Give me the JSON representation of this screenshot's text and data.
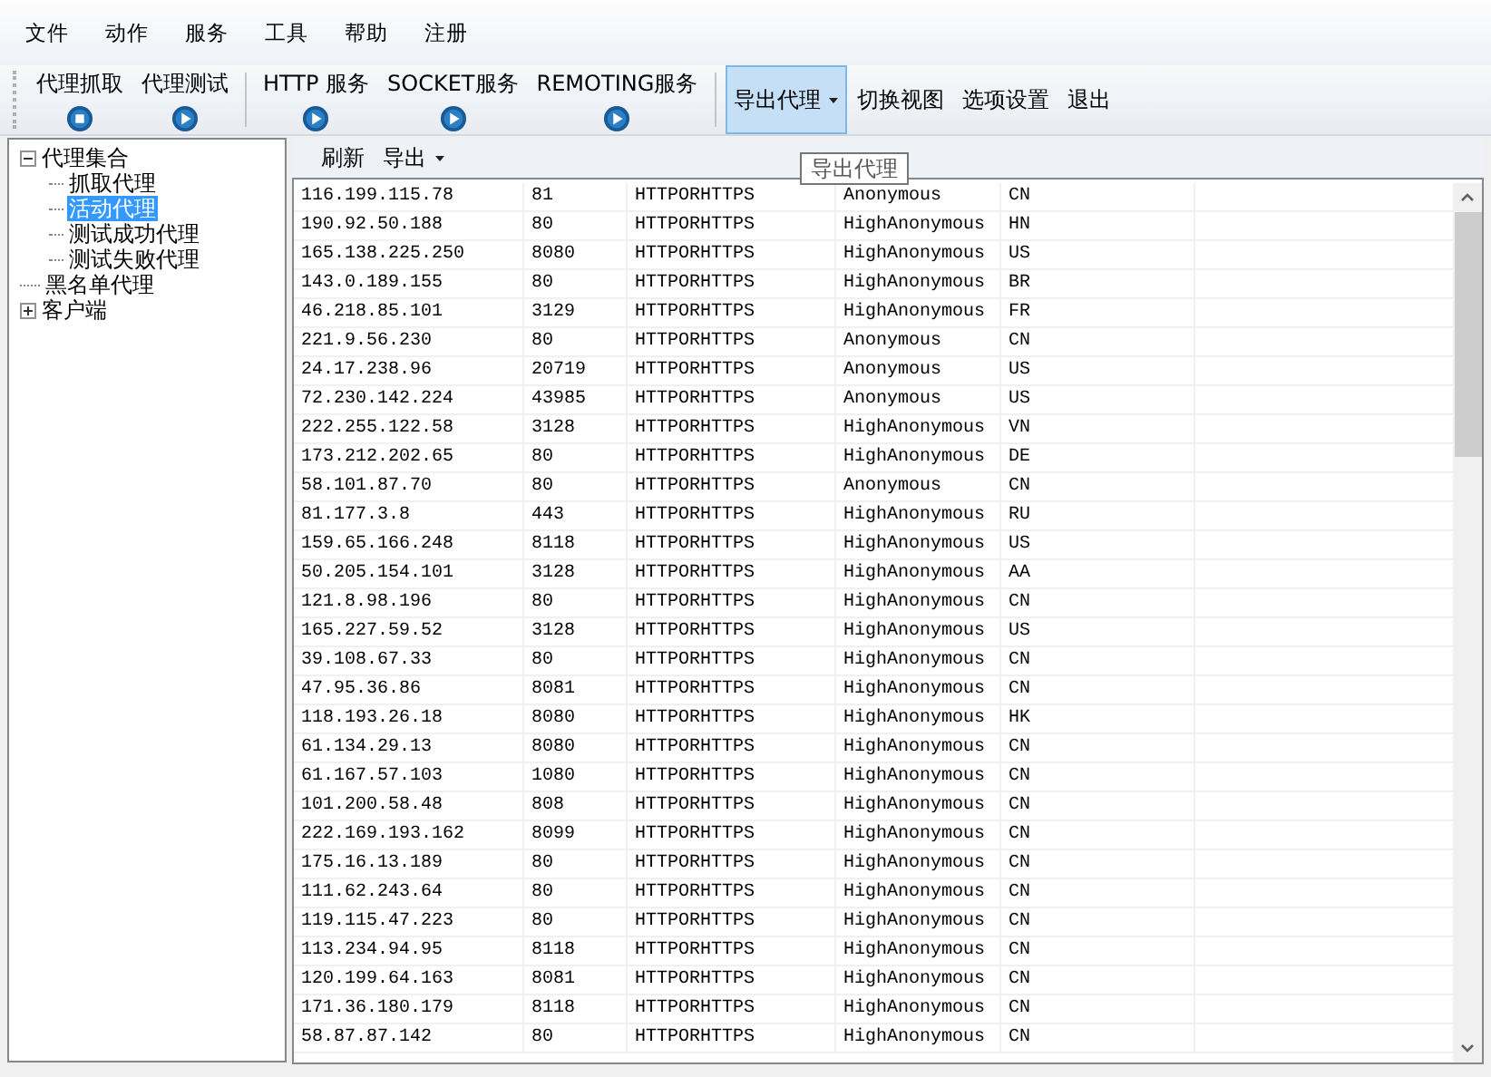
{
  "menu": [
    "文件",
    "动作",
    "服务",
    "工具",
    "帮助",
    "注册"
  ],
  "toolbar": [
    {
      "kind": "stop",
      "label": "代理抓取"
    },
    {
      "kind": "play",
      "label": "代理测试"
    },
    {
      "kind": "separator"
    },
    {
      "kind": "play",
      "label": "HTTP 服务"
    },
    {
      "kind": "play",
      "label": "SOCKET服务"
    },
    {
      "kind": "play",
      "label": "REMOTING服务"
    },
    {
      "kind": "separator"
    },
    {
      "kind": "dropdown",
      "label": "导出代理",
      "hovered": true
    },
    {
      "kind": "text",
      "label": "切换视图"
    },
    {
      "kind": "text",
      "label": "选项设置"
    },
    {
      "kind": "text",
      "label": "退出"
    }
  ],
  "tree": [
    {
      "label": "代理集合",
      "expanded": true,
      "selected": false,
      "children": [
        {
          "label": "抓取代理",
          "selected": false
        },
        {
          "label": "活动代理",
          "selected": true
        },
        {
          "label": "测试成功代理",
          "selected": false
        },
        {
          "label": "测试失败代理",
          "selected": false
        }
      ]
    },
    {
      "label": "黑名单代理",
      "selected": false
    },
    {
      "label": "客户端",
      "expanded": false,
      "selected": false
    }
  ],
  "subtoolbar": [
    {
      "kind": "text",
      "label": "刷新"
    },
    {
      "kind": "dropdown",
      "label": "导出"
    }
  ],
  "tooltip": "导出代理",
  "table": {
    "rows": [
      [
        "116.199.115.78",
        "81",
        "HTTPORHTTPS",
        "Anonymous",
        "CN"
      ],
      [
        "190.92.50.188",
        "80",
        "HTTPORHTTPS",
        "HighAnonymous",
        "HN"
      ],
      [
        "165.138.225.250",
        "8080",
        "HTTPORHTTPS",
        "HighAnonymous",
        "US"
      ],
      [
        "143.0.189.155",
        "80",
        "HTTPORHTTPS",
        "HighAnonymous",
        "BR"
      ],
      [
        "46.218.85.101",
        "3129",
        "HTTPORHTTPS",
        "HighAnonymous",
        "FR"
      ],
      [
        "221.9.56.230",
        "80",
        "HTTPORHTTPS",
        "Anonymous",
        "CN"
      ],
      [
        "24.17.238.96",
        "20719",
        "HTTPORHTTPS",
        "Anonymous",
        "US"
      ],
      [
        "72.230.142.224",
        "43985",
        "HTTPORHTTPS",
        "Anonymous",
        "US"
      ],
      [
        "222.255.122.58",
        "3128",
        "HTTPORHTTPS",
        "HighAnonymous",
        "VN"
      ],
      [
        "173.212.202.65",
        "80",
        "HTTPORHTTPS",
        "HighAnonymous",
        "DE"
      ],
      [
        "58.101.87.70",
        "80",
        "HTTPORHTTPS",
        "Anonymous",
        "CN"
      ],
      [
        "81.177.3.8",
        "443",
        "HTTPORHTTPS",
        "HighAnonymous",
        "RU"
      ],
      [
        "159.65.166.248",
        "8118",
        "HTTPORHTTPS",
        "HighAnonymous",
        "US"
      ],
      [
        "50.205.154.101",
        "3128",
        "HTTPORHTTPS",
        "HighAnonymous",
        "AA"
      ],
      [
        "121.8.98.196",
        "80",
        "HTTPORHTTPS",
        "HighAnonymous",
        "CN"
      ],
      [
        "165.227.59.52",
        "3128",
        "HTTPORHTTPS",
        "HighAnonymous",
        "US"
      ],
      [
        "39.108.67.33",
        "80",
        "HTTPORHTTPS",
        "HighAnonymous",
        "CN"
      ],
      [
        "47.95.36.86",
        "8081",
        "HTTPORHTTPS",
        "HighAnonymous",
        "CN"
      ],
      [
        "118.193.26.18",
        "8080",
        "HTTPORHTTPS",
        "HighAnonymous",
        "HK"
      ],
      [
        "61.134.29.13",
        "8080",
        "HTTPORHTTPS",
        "HighAnonymous",
        "CN"
      ],
      [
        "61.167.57.103",
        "1080",
        "HTTPORHTTPS",
        "HighAnonymous",
        "CN"
      ],
      [
        "101.200.58.48",
        "808",
        "HTTPORHTTPS",
        "HighAnonymous",
        "CN"
      ],
      [
        "222.169.193.162",
        "8099",
        "HTTPORHTTPS",
        "HighAnonymous",
        "CN"
      ],
      [
        "175.16.13.189",
        "80",
        "HTTPORHTTPS",
        "HighAnonymous",
        "CN"
      ],
      [
        "111.62.243.64",
        "80",
        "HTTPORHTTPS",
        "HighAnonymous",
        "CN"
      ],
      [
        "119.115.47.223",
        "80",
        "HTTPORHTTPS",
        "HighAnonymous",
        "CN"
      ],
      [
        "113.234.94.95",
        "8118",
        "HTTPORHTTPS",
        "HighAnonymous",
        "CN"
      ],
      [
        "120.199.64.163",
        "8081",
        "HTTPORHTTPS",
        "HighAnonymous",
        "CN"
      ],
      [
        "171.36.180.179",
        "8118",
        "HTTPORHTTPS",
        "HighAnonymous",
        "CN"
      ],
      [
        "58.87.87.142",
        "80",
        "HTTPORHTTPS",
        "HighAnonymous",
        "CN"
      ]
    ]
  }
}
